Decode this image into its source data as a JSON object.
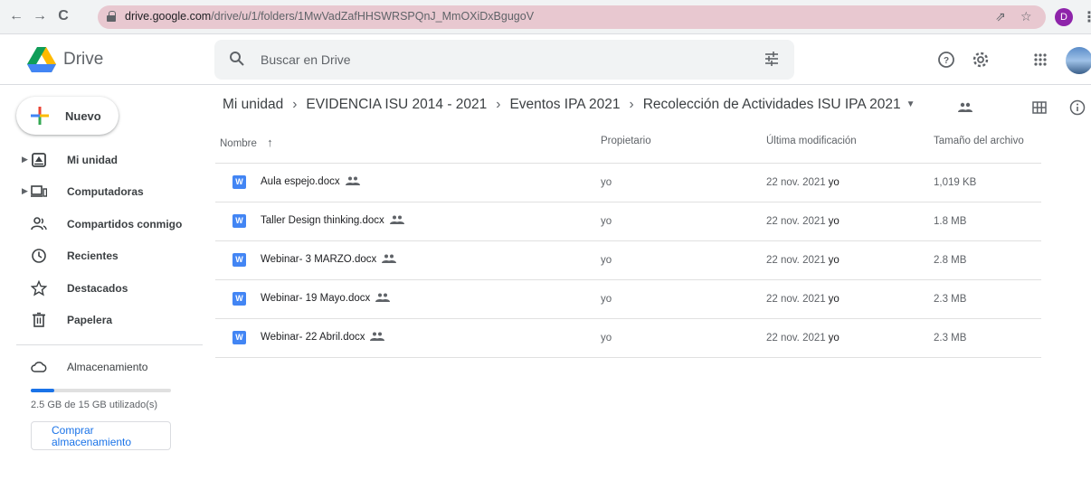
{
  "browser": {
    "url_domain": "drive.google.com",
    "url_path": "/drive/u/1/folders/1MwVadZafHHSWRSPQnJ_MmOXiDxBgugoV",
    "profile_initial": "D"
  },
  "header": {
    "brand": "Drive",
    "search_placeholder": "Buscar en Drive"
  },
  "sidebar": {
    "new_label": "Nuevo",
    "items": [
      {
        "label": "Mi unidad",
        "icon": "drive-icon",
        "expandable": true
      },
      {
        "label": "Computadoras",
        "icon": "computer-icon",
        "expandable": true
      },
      {
        "label": "Compartidos conmigo",
        "icon": "people-icon",
        "expandable": false
      },
      {
        "label": "Recientes",
        "icon": "clock-icon",
        "expandable": false
      },
      {
        "label": "Destacados",
        "icon": "star-icon",
        "expandable": false
      },
      {
        "label": "Papelera",
        "icon": "trash-icon",
        "expandable": false
      }
    ],
    "storage_label": "Almacenamiento",
    "storage_text": "2.5 GB de 15 GB utilizado(s)",
    "storage_fraction": 0.17,
    "buy_label": "Comprar almacenamiento"
  },
  "breadcrumb": [
    "Mi unidad",
    "EVIDENCIA ISU 2014 - 2021",
    "Eventos IPA 2021",
    "Recolección de Actividades ISU IPA 2021"
  ],
  "table": {
    "columns": {
      "name": "Nombre",
      "owner": "Propietario",
      "modified": "Última modificación",
      "size": "Tamaño del archivo"
    },
    "rows": [
      {
        "name": "Aula espejo.docx",
        "owner": "yo",
        "modified_date": "22 nov. 2021",
        "modified_by": "yo",
        "size": "1,019 KB"
      },
      {
        "name": "Taller Design thinking.docx",
        "owner": "yo",
        "modified_date": "22 nov. 2021",
        "modified_by": "yo",
        "size": "1.8 MB"
      },
      {
        "name": "Webinar- 3 MARZO.docx",
        "owner": "yo",
        "modified_date": "22 nov. 2021",
        "modified_by": "yo",
        "size": "2.8 MB"
      },
      {
        "name": "Webinar- 19 Mayo.docx",
        "owner": "yo",
        "modified_date": "22 nov. 2021",
        "modified_by": "yo",
        "size": "2.3 MB"
      },
      {
        "name": "Webinar- 22 Abril.docx",
        "owner": "yo",
        "modified_date": "22 nov. 2021",
        "modified_by": "yo",
        "size": "2.3 MB"
      }
    ]
  },
  "colors": {
    "accent": "#1a73e8",
    "word_blue": "#4285f4",
    "omnibox": "#e8c8d0"
  }
}
